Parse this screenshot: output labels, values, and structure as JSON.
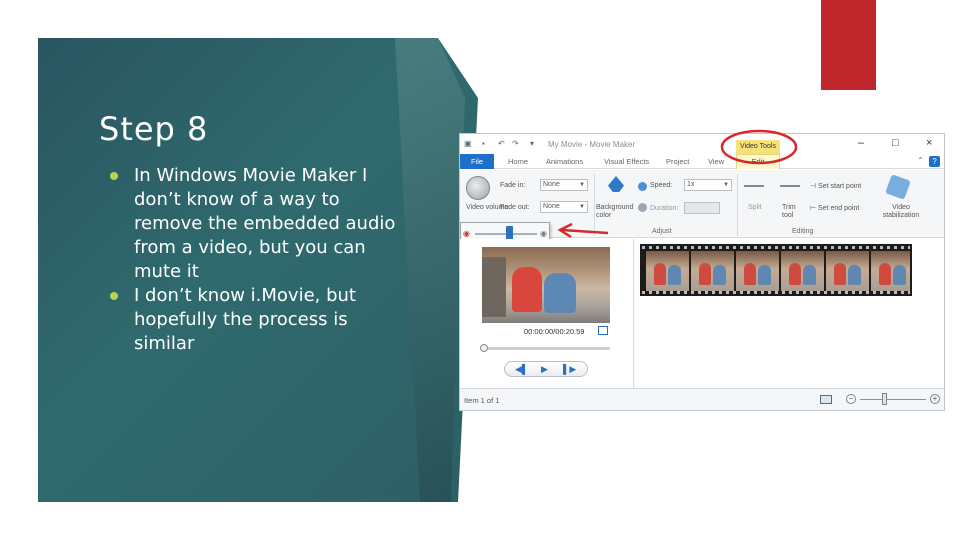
{
  "slide": {
    "title": "Step 8",
    "bullets": [
      "In Windows Movie Maker I don’t know of a way to remove the embedded audio from a video, but you can mute it",
      "I don’t know i.Movie, but hopefully the process is similar"
    ],
    "colors": {
      "panel": "#2f6a6e",
      "accent_red": "#c0272d",
      "bullet": "#b8d24a"
    }
  },
  "app": {
    "window_title": "My Movie",
    "app_name": "Movie Maker",
    "contextual_tab": "Video Tools",
    "menu": [
      "File",
      "Home",
      "Animations",
      "Visual Effects",
      "Project",
      "View",
      "Edit"
    ],
    "ribbon": {
      "video_volume": "Video volume",
      "fade_in": "Fade in:",
      "fade_in_value": "None",
      "fade_out": "Fade out:",
      "fade_out_value": "None",
      "background_color": "Background color",
      "speed": "Speed:",
      "speed_value": "1x",
      "duration": "Duration:",
      "split": "Split",
      "trim_tool": "Trim tool",
      "set_start_point": "Set start point",
      "set_end_point": "Set end point",
      "video_stabilization": "Video stabilization",
      "group_adjust": "Adjust",
      "group_editing": "Editing"
    },
    "preview": {
      "timecode": "00:00:00/00:20.59"
    },
    "status": {
      "item_count": "Item 1 of 1"
    },
    "volume_level": 0.55,
    "annotation_color": "#d62a2a"
  }
}
